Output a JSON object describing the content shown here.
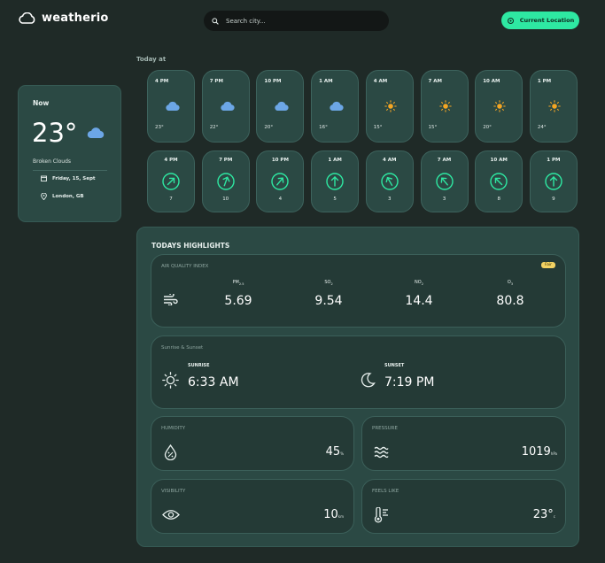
{
  "header": {
    "logo_text": "weatherio",
    "search_placeholder": "Search city...",
    "location_button": "Current Location"
  },
  "now": {
    "title": "Now",
    "temperature": "23°",
    "unit": "c",
    "description": "Broken Clouds",
    "date": "Friday, 15, Sept",
    "location": "London, GB",
    "icon": "cloud-icon"
  },
  "today_at": {
    "label": "Today at",
    "hourly": [
      {
        "time": "4 PM",
        "icon": "cloud-icon",
        "temp": "23°"
      },
      {
        "time": "7 PM",
        "icon": "cloud-icon",
        "temp": "22°"
      },
      {
        "time": "10 PM",
        "icon": "cloud-icon",
        "temp": "20°"
      },
      {
        "time": "1 AM",
        "icon": "cloud-icon",
        "temp": "16°"
      },
      {
        "time": "4 AM",
        "icon": "sun-icon",
        "temp": "15°"
      },
      {
        "time": "7 AM",
        "icon": "sun-icon",
        "temp": "15°"
      },
      {
        "time": "10 AM",
        "icon": "sun-icon",
        "temp": "20°"
      },
      {
        "time": "1 PM",
        "icon": "sun-icon",
        "temp": "24°"
      }
    ],
    "wind": [
      {
        "time": "4 PM",
        "icon": "wind-direction-icon",
        "speed": "7",
        "direction_deg": 45
      },
      {
        "time": "7 PM",
        "icon": "wind-direction-icon",
        "speed": "10",
        "direction_deg": 20
      },
      {
        "time": "10 PM",
        "icon": "wind-direction-icon",
        "speed": "4",
        "direction_deg": 40
      },
      {
        "time": "1 AM",
        "icon": "wind-direction-icon",
        "speed": "5",
        "direction_deg": 0
      },
      {
        "time": "4 AM",
        "icon": "wind-direction-icon",
        "speed": "3",
        "direction_deg": -30
      },
      {
        "time": "7 AM",
        "icon": "wind-direction-icon",
        "speed": "3",
        "direction_deg": -40
      },
      {
        "time": "10 AM",
        "icon": "wind-direction-icon",
        "speed": "8",
        "direction_deg": -45
      },
      {
        "time": "1 PM",
        "icon": "wind-direction-icon",
        "speed": "9",
        "direction_deg": 0
      }
    ]
  },
  "highlights": {
    "title": "TODAYS HIGHLIGHTS",
    "aqi": {
      "title": "AIR QUALITY INDEX",
      "badge": "Fair",
      "items": [
        {
          "label": "PM",
          "sub": "2.5",
          "value": "5.69"
        },
        {
          "label": "SO",
          "sub": "2",
          "value": "9.54"
        },
        {
          "label": "NO",
          "sub": "2",
          "value": "14.4"
        },
        {
          "label": "O",
          "sub": "3",
          "value": "80.8"
        }
      ]
    },
    "sun": {
      "title": "Sunrise & Sunset",
      "sunrise_label": "SUNRISE",
      "sunrise": "6:33 AM",
      "sunset_label": "SUNSET",
      "sunset": "7:19 PM"
    },
    "humidity": {
      "title": "HUMIDITY",
      "value": "45",
      "unit": "%"
    },
    "pressure": {
      "title": "PRESSURE",
      "value": "1019",
      "unit": "hPa"
    },
    "visibility": {
      "title": "VISIBILITY",
      "value": "10",
      "unit": "km"
    },
    "feels_like": {
      "title": "FEELS LIKE",
      "value": "23°",
      "unit": "c"
    }
  },
  "colors": {
    "accent": "#2ee8a2",
    "background": "#1f2a27",
    "card": "#2b4944",
    "sun": "#f5a623",
    "cloud": "#6ca6e6"
  }
}
